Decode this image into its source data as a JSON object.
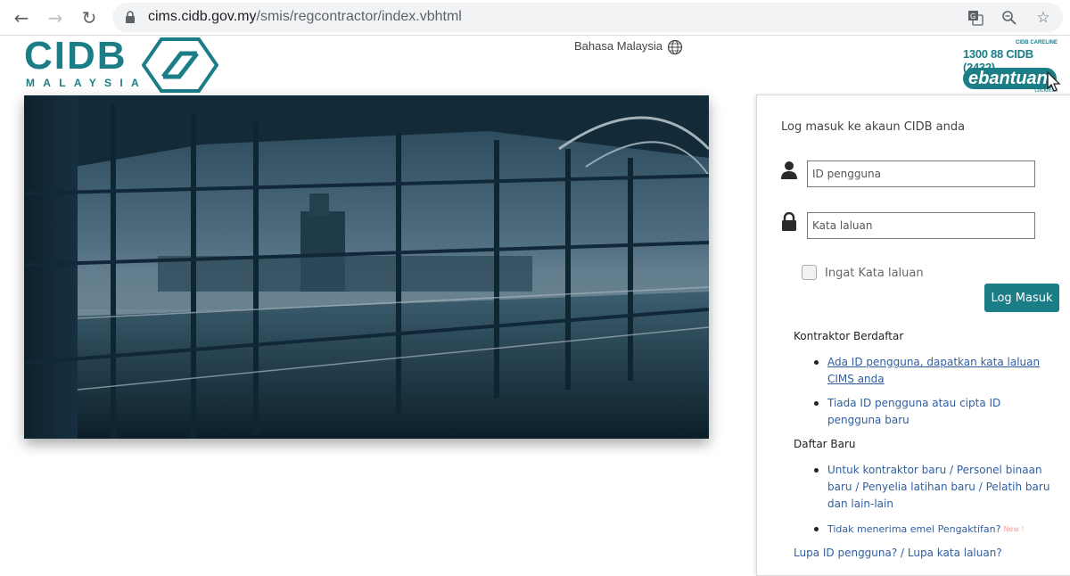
{
  "browser": {
    "url_host": "cims.cidb.gov.my",
    "url_path": "/smis/regcontractor/index.vbhtml"
  },
  "header": {
    "logo_text": "CIDB",
    "logo_sub": "MALAYSIA",
    "language": "Bahasa Malaysia",
    "careline_small": "CIDB CARELINE",
    "careline_phone": "1300 88 CIDB (2432)",
    "ebantuan": "ebantuan",
    "click_text": "click/klik"
  },
  "login": {
    "title": "Log masuk ke akaun CIDB anda",
    "username_placeholder": "ID pengguna",
    "password_placeholder": "Kata laluan",
    "remember_label": "Ingat Kata laluan",
    "login_button": "Log Masuk"
  },
  "registered": {
    "heading": "Kontraktor Berdaftar",
    "links": [
      "Ada ID pengguna, dapatkan kata laluan CIMS anda",
      "Tiada ID pengguna atau cipta ID pengguna baru"
    ]
  },
  "new_registration": {
    "heading": "Daftar Baru",
    "links": [
      "Untuk kontraktor baru / Personel binaan baru / Penyelia latihan baru / Pelatih baru dan lain-lain",
      "Tidak menerima emel Pengaktifan?"
    ],
    "new_badge": "New !"
  },
  "forgot": "Lupa ID pengguna? / Lupa kata laluan?",
  "colors": {
    "brand_teal": "#1b7d86",
    "link_blue": "#2f5fa0"
  }
}
